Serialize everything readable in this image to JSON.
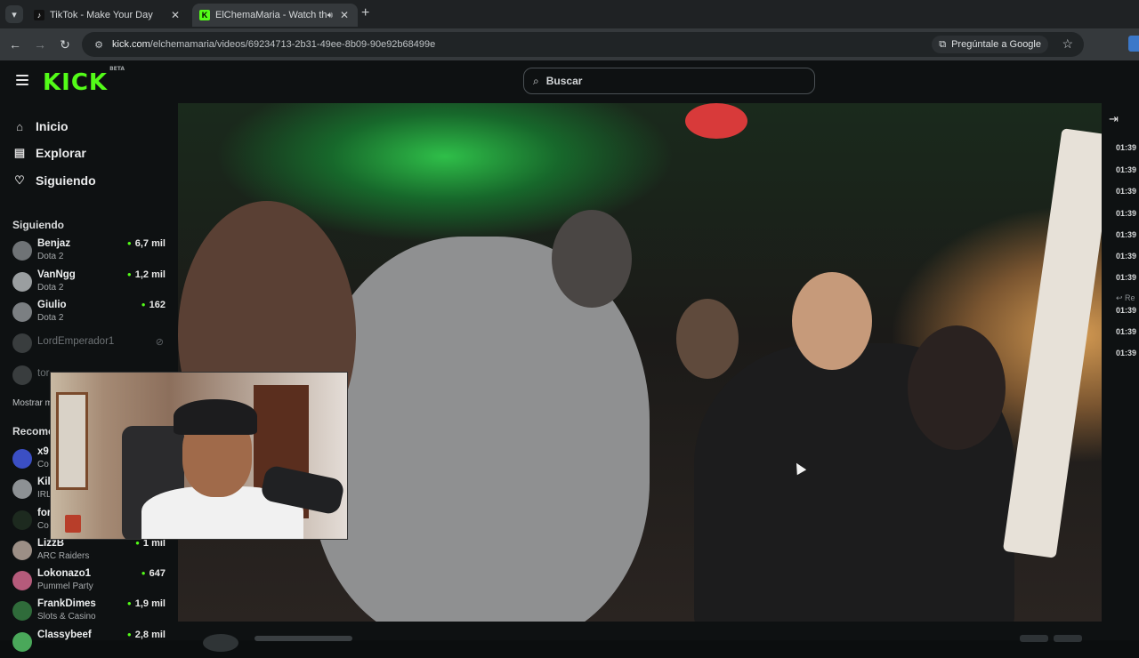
{
  "browser": {
    "tabs": [
      {
        "title": "TikTok - Make Your Day",
        "favicon": "tiktok-icon",
        "active": false
      },
      {
        "title": "ElChemaMaria - Watch the",
        "favicon": "kick-icon",
        "active": true
      }
    ],
    "url_domain": "kick.com",
    "url_path": "/elchemamaria/videos/69234713-2b31-49ee-8b09-90e92b68499e",
    "ask_google": "Pregúntale a Google"
  },
  "header": {
    "logo": "KICK",
    "logo_tag": "BETA",
    "search_placeholder": "Buscar"
  },
  "sidebar": {
    "nav": [
      {
        "label": "Inicio",
        "icon": "home-icon"
      },
      {
        "label": "Explorar",
        "icon": "explore-icon"
      },
      {
        "label": "Siguiendo",
        "icon": "heart-icon"
      }
    ],
    "following_title": "Siguiendo",
    "following": [
      {
        "name": "Benjaz",
        "category": "Dota 2",
        "viewers": "6,7 mil"
      },
      {
        "name": "VanNgg",
        "category": "Dota 2",
        "viewers": "1,2 mil"
      },
      {
        "name": "Giulio",
        "category": "Dota 2",
        "viewers": "162"
      },
      {
        "name": "LordEmperador1",
        "category": "",
        "viewers": ""
      },
      {
        "name": "tor",
        "category": "",
        "viewers": ""
      }
    ],
    "show_more": "Mostrar m",
    "recommended_title": "Recome",
    "recommended": [
      {
        "name": "x9",
        "category": "Co",
        "viewers": ""
      },
      {
        "name": "Kil",
        "category": "IRL",
        "viewers": ""
      },
      {
        "name": "for",
        "category": "Co",
        "viewers": ""
      },
      {
        "name": "LizzB",
        "category": "ARC Raiders",
        "viewers": "1 mil"
      },
      {
        "name": "Lokonazo1",
        "category": "Pummel Party",
        "viewers": "647"
      },
      {
        "name": "FrankDimes",
        "category": "Slots & Casino",
        "viewers": "1,9 mil"
      },
      {
        "name": "Classybeef",
        "category": "",
        "viewers": "2,8 mil"
      }
    ]
  },
  "chat_timestamps": [
    "01:39",
    "01:39",
    "01:39",
    "01:39",
    "01:39",
    "01:39",
    "01:39",
    "Re",
    "01:39",
    "01:39",
    "01:39"
  ],
  "colors": {
    "brand": "#53fc18",
    "background": "#0e1112"
  }
}
